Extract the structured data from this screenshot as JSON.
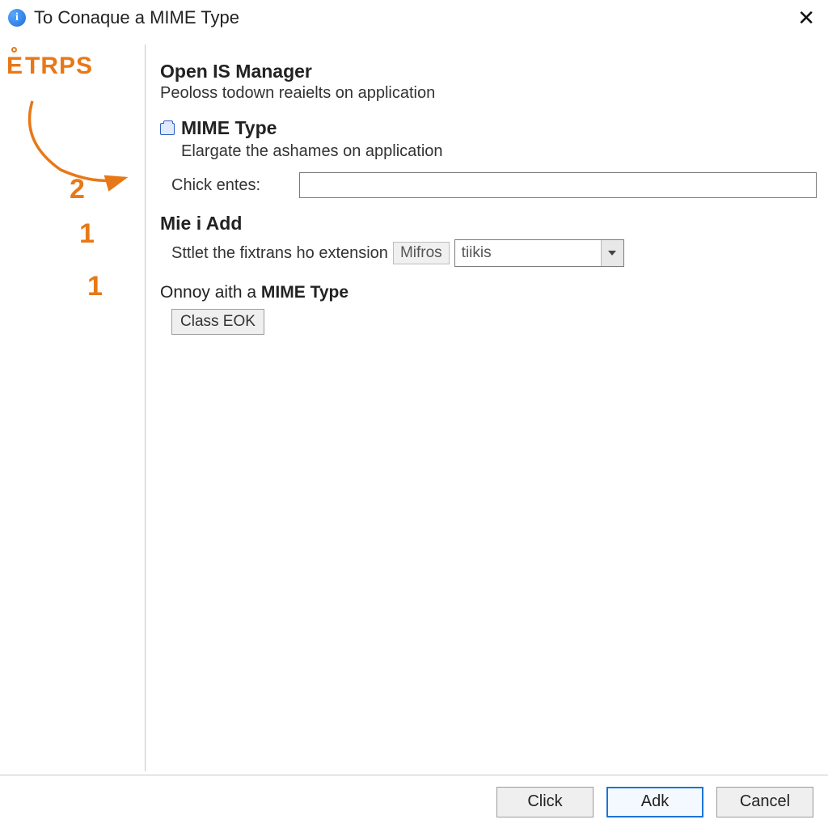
{
  "titlebar": {
    "title": "To Conaque a MIME Type"
  },
  "sidebar": {
    "brand_prefix": "E",
    "brand_rest": "TRPS",
    "steps": [
      "2",
      "1",
      "1"
    ]
  },
  "content": {
    "heading1": "Open IS Manager",
    "sub1": "Peoloss todown reaielts on application",
    "mime_label": "MIME Type",
    "mime_sub": "Elargate the ashames on application",
    "input_label": "Chick entes:",
    "input_value": "",
    "add_heading": "Mie i Add",
    "ext_label": "Sttlet the fixtrans ho extension",
    "suffix": "Mifros",
    "combo_value": "tiikis",
    "final_pre": "Onnoy aith a ",
    "final_bold": "MIME Type",
    "class_btn": "Class EOK"
  },
  "footer": {
    "btn1": "Click",
    "btn2": "Adk",
    "btn3": "Cancel"
  }
}
